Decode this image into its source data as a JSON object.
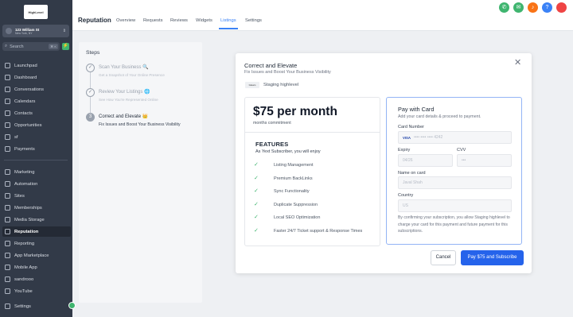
{
  "brand": {
    "logo_text": "HighLevel"
  },
  "location": {
    "name": "123 William St",
    "city": "New York, NY"
  },
  "search": {
    "placeholder": "Search",
    "shortcut": "⌘ K"
  },
  "sidebar": {
    "items": [
      {
        "label": "Launchpad",
        "icon": "rocket-icon"
      },
      {
        "label": "Dashboard",
        "icon": "dashboard-icon"
      },
      {
        "label": "Conversations",
        "icon": "chat-icon"
      },
      {
        "label": "Calendars",
        "icon": "calendar-icon"
      },
      {
        "label": "Contacts",
        "icon": "contacts-icon"
      },
      {
        "label": "Opportunities",
        "icon": "opportunities-icon"
      },
      {
        "label": "sf",
        "icon": "sf-icon"
      },
      {
        "label": "Payments",
        "icon": "payments-icon"
      },
      {
        "label": "Marketing",
        "icon": "marketing-icon"
      },
      {
        "label": "Automation",
        "icon": "automation-icon"
      },
      {
        "label": "Sites",
        "icon": "sites-icon"
      },
      {
        "label": "Memberships",
        "icon": "memberships-icon"
      },
      {
        "label": "Media Storage",
        "icon": "media-icon"
      },
      {
        "label": "Reputation",
        "icon": "reputation-icon",
        "active": true
      },
      {
        "label": "Reporting",
        "icon": "reporting-icon"
      },
      {
        "label": "App Marketplace",
        "icon": "marketplace-icon"
      },
      {
        "label": "Mobile App",
        "icon": "mobile-icon"
      },
      {
        "label": "sandrooo",
        "icon": "sandrooo-icon"
      },
      {
        "label": "YouTube",
        "icon": "youtube-icon"
      }
    ],
    "settings_label": "Settings"
  },
  "header": {
    "title": "Reputation",
    "tabs": [
      "Overview",
      "Requests",
      "Reviews",
      "Widgets",
      "Listings",
      "Settings"
    ],
    "active_tab": "Listings"
  },
  "steps": {
    "heading": "Steps",
    "items": [
      {
        "title": "Scan Your Business 🔍",
        "subtitle": "Get a Snapshot of Your Online Presence",
        "state": "done"
      },
      {
        "title": "Review Your Listings 🌐",
        "subtitle": "See How You're Represented Online",
        "state": "done"
      },
      {
        "number": "3",
        "title": "Correct and Elevate 👑",
        "subtitle": "Fix Issues and Boost Your Business Visibility",
        "state": "current"
      }
    ]
  },
  "dialog": {
    "title": "Correct and Elevate",
    "subtitle": "Fix Issues and Boost Your Business Visibility",
    "brand_chip": "Gleam",
    "business_name": "Staging highlevel",
    "price": "$75 per month",
    "commitment": "months commitment",
    "features_heading": "FEATURES",
    "features_sub": "As Yext Subscriber, you will enjoy",
    "features": [
      "Listing Management",
      "Premium BackLinks",
      "Sync Functionality",
      "Duplicate Suppression",
      "Local SEO Optimization",
      "Faster 24/7 Ticket support & Response Times"
    ],
    "payment": {
      "heading": "Pay with Card",
      "subheading": "Add your card details & proceed to payment.",
      "card_label": "Card Number",
      "card_brand": "VISA",
      "card_value": "•••• •••• •••• 4242",
      "expiry_label": "Expiry",
      "expiry_value": "04/26",
      "cvv_label": "CVV",
      "cvv_value": "•••",
      "name_label": "Name on card",
      "name_value": "Javal Shah",
      "country_label": "Country",
      "country_value": "US",
      "consent": "By confirming your subscription, you allow Staging highlevel to charge your card for this payment and future payment for this subscriptions."
    },
    "cancel_label": "Cancel",
    "pay_label": "Pay $75 and Subscribe"
  },
  "colors": {
    "primary": "#2563eb",
    "sidebar": "#323a48",
    "success": "#3fb56f",
    "warning": "#f59e0b"
  }
}
